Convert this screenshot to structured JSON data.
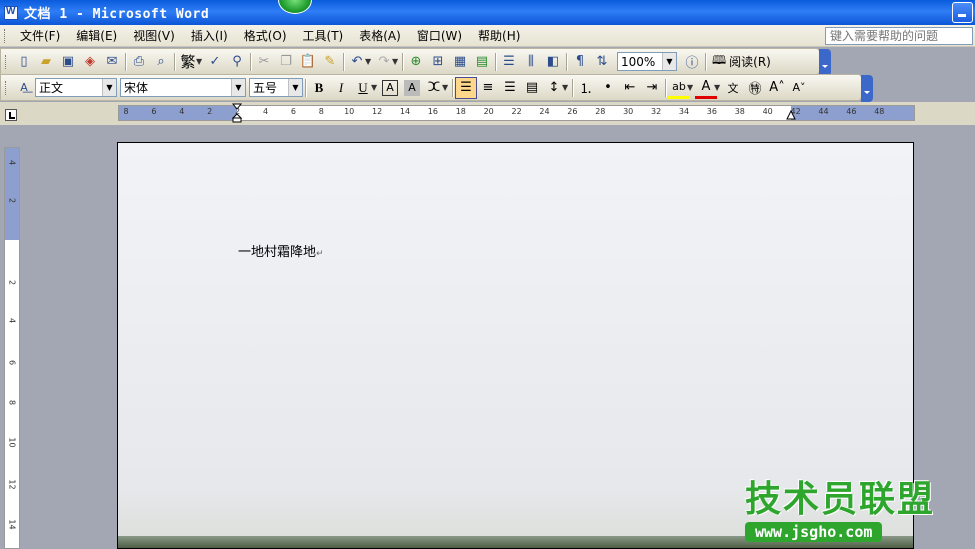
{
  "window": {
    "title": "文档 1 - Microsoft Word"
  },
  "menubar": {
    "items": [
      "文件(F)",
      "编辑(E)",
      "视图(V)",
      "插入(I)",
      "格式(O)",
      "工具(T)",
      "表格(A)",
      "窗口(W)",
      "帮助(H)"
    ],
    "help_placeholder": "键入需要帮助的问题"
  },
  "standard_toolbar": {
    "traditional_label": "繁",
    "zoom": "100%",
    "read_label": "阅读(R)"
  },
  "format_toolbar": {
    "style": "正文",
    "font": "宋体",
    "size": "五号",
    "bold": "B",
    "italic": "I",
    "underline": "U",
    "align_selected": "left"
  },
  "ruler": {
    "h_ticks": [
      "8",
      "6",
      "4",
      "2",
      "2",
      "4",
      "6",
      "8",
      "10",
      "12",
      "14",
      "16",
      "18",
      "20",
      "22",
      "24",
      "26",
      "28",
      "30",
      "32",
      "34",
      "36",
      "38",
      "40",
      "42",
      "44",
      "46",
      "48"
    ],
    "v_ticks": [
      "4",
      "2",
      "2",
      "4",
      "6",
      "8",
      "10",
      "12",
      "14"
    ]
  },
  "document": {
    "text": "一地村霜降地"
  },
  "watermark": {
    "name": "技术员联盟",
    "url": "www.jsgho.com"
  },
  "colors": {
    "title_bar": "#0a5cdc",
    "menu_bg": "#ece9d8",
    "watermark_green": "#2ea62e"
  }
}
